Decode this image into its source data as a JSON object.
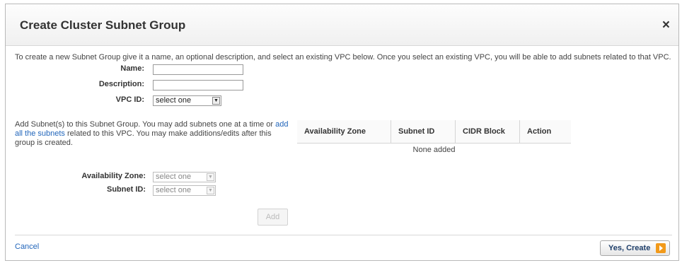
{
  "dialog": {
    "title": "Create Cluster Subnet Group",
    "close": "×"
  },
  "intro": "To create a new Subnet Group give it a name, an optional description, and select an existing VPC below. Once you select an existing VPC, you will be able to add subnets related to that VPC.",
  "form": {
    "name_label": "Name:",
    "description_label": "Description:",
    "vpc_label": "VPC ID:",
    "vpc_value": "select one"
  },
  "help": {
    "text_before": "Add Subnet(s) to this Subnet Group. You may add subnets one at a time or ",
    "link": "add all the subnets",
    "text_after": " related to this VPC. You may make additions/edits after this group is created."
  },
  "table": {
    "headers": [
      "Availability Zone",
      "Subnet ID",
      "CIDR Block",
      "Action"
    ],
    "empty": "None added"
  },
  "add_form": {
    "zone_label": "Availability Zone:",
    "zone_value": "select one",
    "subnet_label": "Subnet ID:",
    "subnet_value": "select one",
    "add_label": "Add"
  },
  "footer": {
    "cancel": "Cancel",
    "yes": "Yes, Create"
  }
}
